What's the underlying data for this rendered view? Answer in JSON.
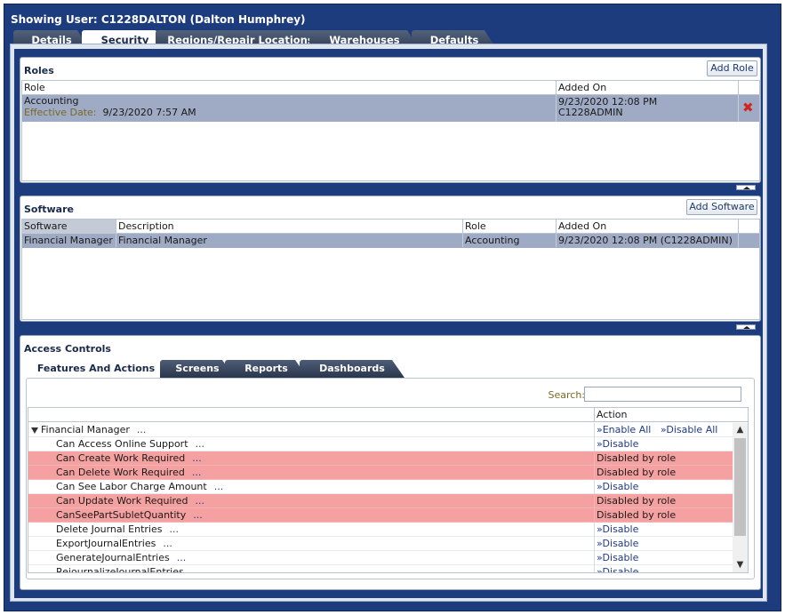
{
  "header": {
    "title": "Showing User: C1228DALTON (Dalton Humphrey)"
  },
  "main_tabs": [
    {
      "label": "Details",
      "active": false
    },
    {
      "label": "Security",
      "active": true
    },
    {
      "label": "Regions/Repair Locations",
      "active": false
    },
    {
      "label": "Warehouses",
      "active": false
    },
    {
      "label": "Defaults",
      "active": false
    }
  ],
  "roles": {
    "title": "Roles",
    "add_button": "Add Role",
    "columns": [
      "Role",
      "Added On"
    ],
    "rows": [
      {
        "role": "Accounting",
        "effective_label": "Effective Date:",
        "effective_date": "9/23/2020 7:57 AM",
        "added_on": "9/23/2020 12:08 PM",
        "added_by": "C1228ADMIN"
      }
    ]
  },
  "software": {
    "title": "Software",
    "add_button": "Add Software",
    "columns": [
      "Software",
      "Description",
      "Role",
      "Added On"
    ],
    "rows": [
      {
        "software": "Financial Manager",
        "description": "Financial Manager",
        "role": "Accounting",
        "added_on": "9/23/2020 12:08 PM (C1228ADMIN)"
      }
    ]
  },
  "access_controls": {
    "title": "Access Controls",
    "tabs": [
      {
        "label": "Features And Actions",
        "active": true
      },
      {
        "label": "Screens",
        "active": false
      },
      {
        "label": "Reports",
        "active": false
      },
      {
        "label": "Dashboards",
        "active": false
      }
    ],
    "search_label": "Search:",
    "search_value": "",
    "action_header": "Action",
    "group": {
      "name": "Financial Manager",
      "dots": "...",
      "enable_all": "Enable All",
      "disable_all": "Disable All"
    },
    "features": [
      {
        "name": "Can Access Online Support",
        "dots": "...",
        "action": "Disable",
        "disabled": false
      },
      {
        "name": "Can Create Work Required",
        "dots": "...",
        "action": "Disabled by role",
        "disabled": true
      },
      {
        "name": "Can Delete Work Required",
        "dots": "...",
        "action": "Disabled by role",
        "disabled": true
      },
      {
        "name": "Can See Labor Charge Amount",
        "dots": "...",
        "action": "Disable",
        "disabled": false
      },
      {
        "name": "Can Update Work Required",
        "dots": "...",
        "action": "Disabled by role",
        "disabled": true
      },
      {
        "name": "CanSeePartSubletQuantity",
        "dots": "...",
        "action": "Disabled by role",
        "disabled": true
      },
      {
        "name": "Delete Journal Entries",
        "dots": "...",
        "action": "Disable",
        "disabled": false
      },
      {
        "name": "ExportJournalEntries",
        "dots": "...",
        "action": "Disable",
        "disabled": false
      },
      {
        "name": "GenerateJournalEntries",
        "dots": "...",
        "action": "Disable",
        "disabled": false
      },
      {
        "name": "RejournalizeJournalEntries",
        "dots": "...",
        "action": "Disable",
        "disabled": false
      }
    ],
    "link_prefix": "»",
    "colors": {
      "disabled_row": "#f5a1a1",
      "selected_row": "#9faac4",
      "frame_blue": "#1d3c7d"
    }
  }
}
